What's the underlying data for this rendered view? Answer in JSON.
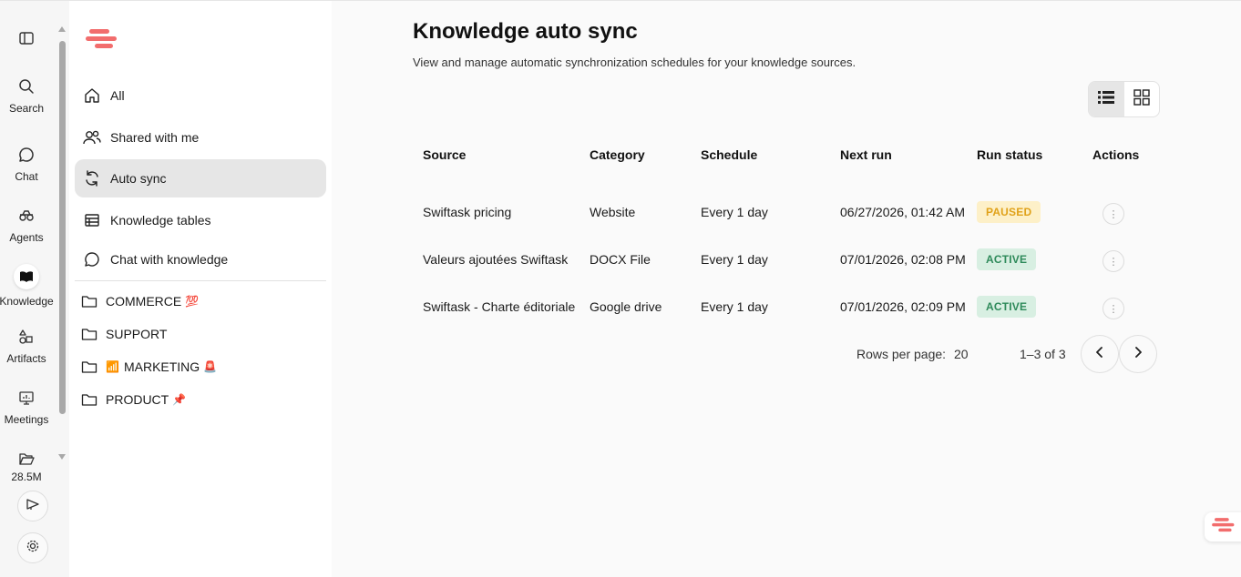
{
  "rail": {
    "items": [
      {
        "name": "sidebar-toggle",
        "label": ""
      },
      {
        "name": "search",
        "label": "Search"
      },
      {
        "name": "chat",
        "label": "Chat"
      },
      {
        "name": "agents",
        "label": "Agents"
      },
      {
        "name": "knowledge",
        "label": "Knowledge"
      },
      {
        "name": "artifacts",
        "label": "Artifacts"
      },
      {
        "name": "meetings",
        "label": "Meetings"
      },
      {
        "name": "storage",
        "label": "28.5M"
      }
    ]
  },
  "sidebar": {
    "nav": [
      {
        "label": "All",
        "icon": "home-icon"
      },
      {
        "label": "Shared with me",
        "icon": "users-icon"
      },
      {
        "label": "Auto sync",
        "icon": "sync-icon"
      },
      {
        "label": "Knowledge tables",
        "icon": "table-icon"
      },
      {
        "label": "Chat with knowledge",
        "icon": "chat-bubble-icon"
      }
    ],
    "folders": [
      {
        "label": "COMMERCE",
        "emoji_before": "",
        "emoji_after": "💯"
      },
      {
        "label": "SUPPORT",
        "emoji_before": "",
        "emoji_after": ""
      },
      {
        "label": "MARKETING",
        "emoji_before": "📶",
        "emoji_after": "🚨"
      },
      {
        "label": "PRODUCT",
        "emoji_before": "",
        "emoji_after": "📌"
      }
    ]
  },
  "main": {
    "title": "Knowledge auto sync",
    "subtitle": "View and manage automatic synchronization schedules for your knowledge sources.",
    "table": {
      "headers": [
        "Source",
        "Category",
        "Schedule",
        "Next run",
        "Run status",
        "Actions"
      ],
      "rows": [
        {
          "source": "Swiftask pricing",
          "category": "Website",
          "schedule": "Every 1 day",
          "next_run": "06/27/2026, 01:42 AM",
          "status": "PAUSED"
        },
        {
          "source": "Valeurs ajoutées Swiftask",
          "category": "DOCX File",
          "schedule": "Every 1 day",
          "next_run": "07/01/2026, 02:08 PM",
          "status": "ACTIVE"
        },
        {
          "source": "Swiftask - Charte éditoriale",
          "category": "Google drive",
          "schedule": "Every 1 day",
          "next_run": "07/01/2026, 02:09 PM",
          "status": "ACTIVE"
        }
      ]
    },
    "pager": {
      "rows_per_page_label": "Rows per page:",
      "rows_per_page": "20",
      "range": "1–3 of 3"
    }
  },
  "colors": {
    "brand": "#f26d6d",
    "paused_bg": "#fdf0c8",
    "paused_fg": "#e0a21a",
    "active_bg": "#d8efe2",
    "active_fg": "#2e8a5a"
  }
}
